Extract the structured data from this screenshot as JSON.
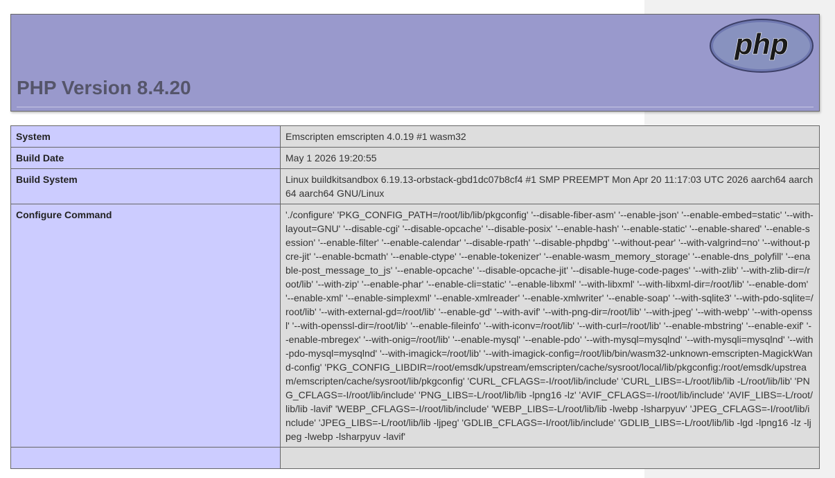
{
  "header": {
    "title": "PHP Version 8.4.20",
    "logo_text": "php"
  },
  "rows": [
    {
      "key": "System",
      "value": "Emscripten emscripten 4.0.19 #1 wasm32"
    },
    {
      "key": "Build Date",
      "value": "May 1 2026 19:20:55"
    },
    {
      "key": "Build System",
      "value": "Linux buildkitsandbox 6.19.13-orbstack-gbd1dc07b8cf4 #1 SMP PREEMPT Mon Apr 20 11:17:03 UTC 2026 aarch64 aarch64 aarch64 GNU/Linux"
    },
    {
      "key": "Configure Command",
      "value": "'./configure' 'PKG_CONFIG_PATH=/root/lib/lib/pkgconfig' '--disable-fiber-asm' '--enable-json' '--enable-embed=static' '--with-layout=GNU' '--disable-cgi' '--disable-opcache' '--disable-posix' '--enable-hash' '--enable-static' '--enable-shared' '--enable-session' '--enable-filter' '--enable-calendar' '--disable-rpath' '--disable-phpdbg' '--without-pear' '--with-valgrind=no' '--without-pcre-jit' '--enable-bcmath' '--enable-ctype' '--enable-tokenizer' '--enable-wasm_memory_storage' '--enable-dns_polyfill' '--enable-post_message_to_js' '--enable-opcache' '--disable-opcache-jit' '--disable-huge-code-pages' '--with-zlib' '--with-zlib-dir=/root/lib' '--with-zip' '--enable-phar' '--enable-cli=static' '--enable-libxml' '--with-libxml' '--with-libxml-dir=/root/lib' '--enable-dom' '--enable-xml' '--enable-simplexml' '--enable-xmlreader' '--enable-xmlwriter' '--enable-soap' '--with-sqlite3' '--with-pdo-sqlite=/root/lib' '--with-external-gd=/root/lib' '--enable-gd' '--with-avif' '--with-png-dir=/root/lib' '--with-jpeg' '--with-webp' '--with-openssl' '--with-openssl-dir=/root/lib' '--enable-fileinfo' '--with-iconv=/root/lib' '--with-curl=/root/lib' '--enable-mbstring' '--enable-exif' '--enable-mbregex' '--with-onig=/root/lib' '--enable-mysql' '--enable-pdo' '--with-mysql=mysqlnd' '--with-mysqli=mysqlnd' '--with-pdo-mysql=mysqlnd' '--with-imagick=/root/lib' '--with-imagick-config=/root/lib/bin/wasm32-unknown-emscripten-MagickWand-config' 'PKG_CONFIG_LIBDIR=/root/emsdk/upstream/emscripten/cache/sysroot/local/lib/pkgconfig:/root/emsdk/upstream/emscripten/cache/sysroot/lib/pkgconfig' 'CURL_CFLAGS=-I/root/lib/include' 'CURL_LIBS=-L/root/lib/lib -L/root/lib/lib' 'PNG_CFLAGS=-I/root/lib/include' 'PNG_LIBS=-L/root/lib/lib -lpng16 -lz' 'AVIF_CFLAGS=-I/root/lib/include' 'AVIF_LIBS=-L/root/lib/lib -lavif' 'WEBP_CFLAGS=-I/root/lib/include' 'WEBP_LIBS=-L/root/lib/lib -lwebp -lsharpyuv' 'JPEG_CFLAGS=-I/root/lib/include' 'JPEG_LIBS=-L/root/lib/lib -ljpeg' 'GDLIB_CFLAGS=-I/root/lib/include' 'GDLIB_LIBS=-L/root/lib/lib -lgd -lpng16 -lz -ljpeg -lwebp -lsharpyuv -lavif'"
    },
    {
      "key": "",
      "value": ""
    }
  ],
  "colors": {
    "header_bg": "#9999cc",
    "key_bg": "#ccccff",
    "value_bg": "#dddddd",
    "title_color": "#55556a"
  }
}
